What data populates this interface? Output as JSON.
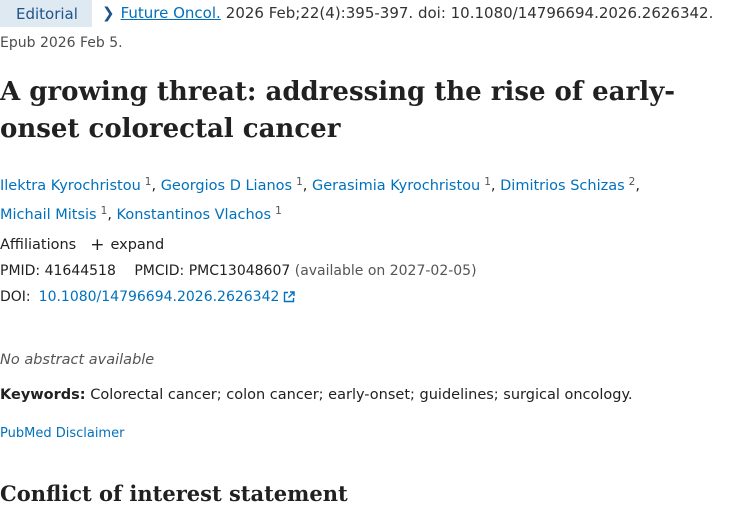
{
  "header": {
    "publication_type": "Editorial",
    "journal": "Future Oncol.",
    "citation_rest": "2026 Feb;22(4):395-397. doi: 10.1080/14796694.2026.2626342.",
    "epub": "Epub 2026 Feb 5."
  },
  "article": {
    "title": "A growing threat: addressing the rise of early-onset colorectal cancer"
  },
  "authors": [
    {
      "name": "Ilektra Kyrochristou",
      "affiliation": "1"
    },
    {
      "name": "Georgios D Lianos",
      "affiliation": "1"
    },
    {
      "name": "Gerasimia Kyrochristou",
      "affiliation": "1"
    },
    {
      "name": "Dimitrios Schizas",
      "affiliation": "2"
    },
    {
      "name": "Michail Mitsis",
      "affiliation": "1"
    },
    {
      "name": "Konstantinos Vlachos",
      "affiliation": "1"
    }
  ],
  "affiliations": {
    "label": "Affiliations",
    "expand_label": "expand"
  },
  "identifiers": {
    "pmid_label": "PMID:",
    "pmid": "41644518",
    "pmcid_label": "PMCID:",
    "pmcid": "PMC13048607",
    "pmc_note": "(available on 2027-02-05)",
    "doi_label": "DOI:",
    "doi": "10.1080/14796694.2026.2626342"
  },
  "abstract": {
    "text": "No abstract available"
  },
  "keywords": {
    "label": "Keywords:",
    "text": "Colorectal cancer; colon cancer; early-onset; guidelines; surgical oncology."
  },
  "disclaimer": {
    "label": "PubMed Disclaimer"
  },
  "sections": {
    "coi_heading": "Conflict of interest statement"
  }
}
